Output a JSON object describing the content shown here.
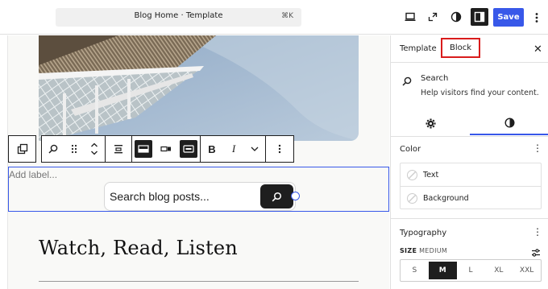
{
  "header": {
    "command_title": "Blog Home · Template",
    "command_shortcut": "⌘K",
    "save_label": "Save",
    "icons": [
      "desktop-view-icon",
      "external-link-icon",
      "styles-icon",
      "settings-panel-icon",
      "more-options-icon"
    ]
  },
  "canvas": {
    "search_block": {
      "label_placeholder": "Add label...",
      "input_placeholder": "Search blog posts..."
    },
    "heading": "Watch, Read, Listen"
  },
  "sidebar": {
    "tabs": [
      "Template",
      "Block"
    ],
    "active_tab": "Block",
    "block": {
      "title": "Search",
      "description": "Help visitors find your content."
    },
    "color_panel": {
      "title": "Color",
      "items": [
        "Text",
        "Background"
      ]
    },
    "typography_panel": {
      "title": "Typography",
      "size_label": "SIZE",
      "size_value": "MEDIUM",
      "size_options": [
        "S",
        "M",
        "L",
        "XL",
        "XXL"
      ],
      "active_size": "M"
    }
  },
  "colors": {
    "accent": "#3858e9",
    "highlight_border": "#d91c1c",
    "dark": "#1e1e1e"
  }
}
